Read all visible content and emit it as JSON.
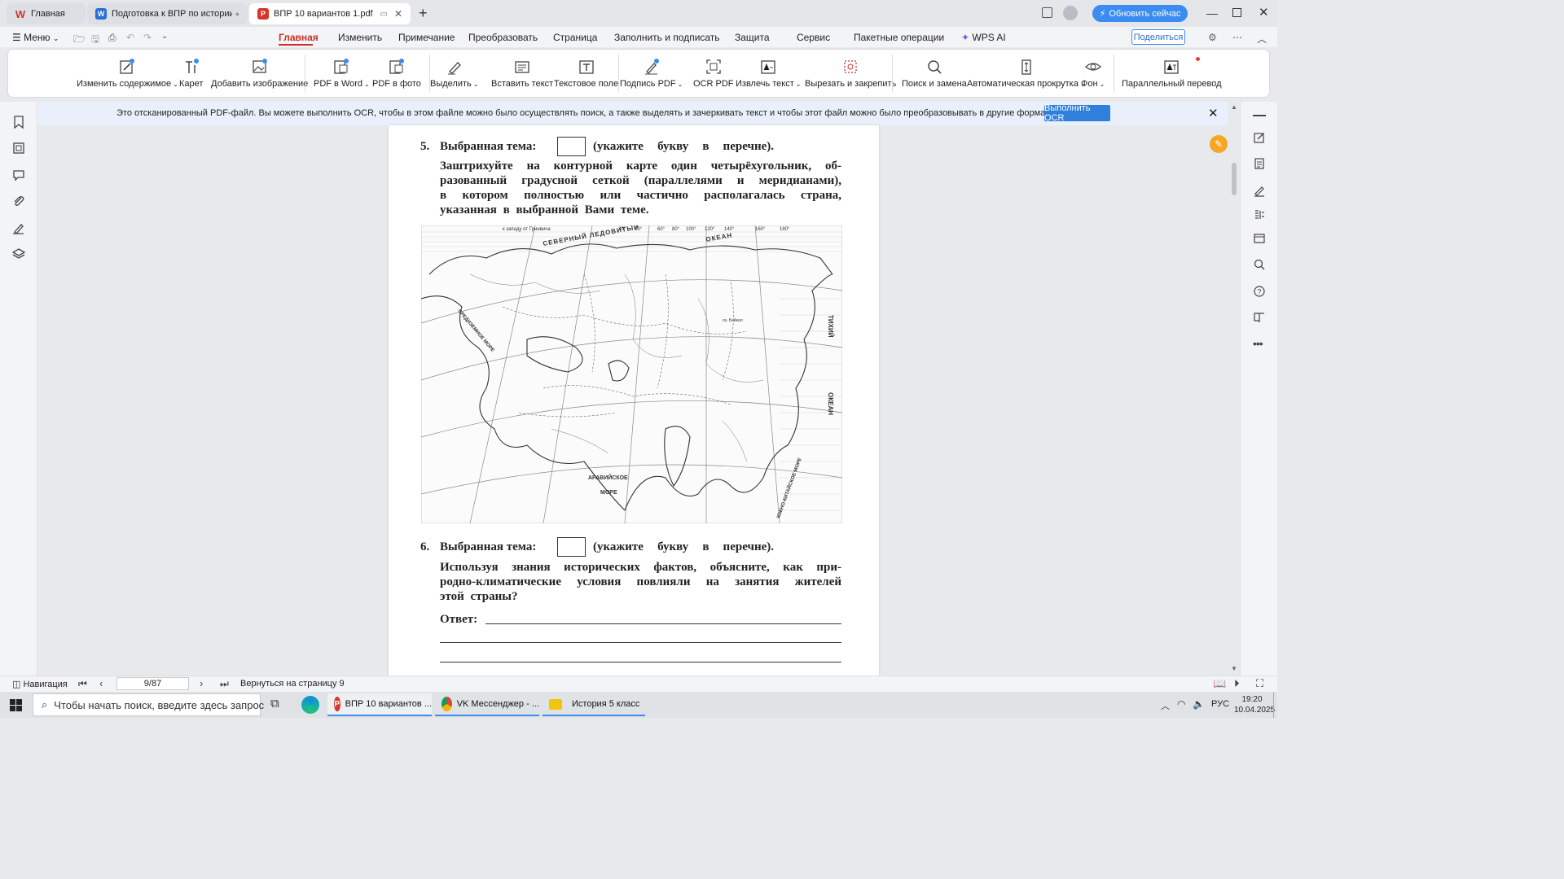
{
  "tabs": [
    {
      "label": "Главная",
      "icon": "wps-logo-icon"
    },
    {
      "label": "Подготовка к ВПР по истории в 5",
      "icon": "word-doc-icon"
    },
    {
      "label": "ВПР 10 вариантов 1.pdf",
      "icon": "pdf-icon"
    }
  ],
  "header": {
    "update_label": "Обновить сейчас",
    "share_label": "Поделиться"
  },
  "menu": {
    "menu_label": "Меню",
    "items": [
      "Главная",
      "Изменить",
      "Примечание",
      "Преобразовать",
      "Страница",
      "Заполнить и подписать",
      "Защита",
      "Сервис",
      "Пакетные операции",
      "WPS AI"
    ],
    "active": "Главная"
  },
  "ribbon": {
    "tools": [
      "Изменить содержимое",
      "Карет",
      "Добавить изображение",
      "PDF в Word",
      "PDF в фото",
      "Выделить",
      "Вставить текст",
      "Текстовое поле",
      "Подпись PDF",
      "OCR PDF",
      "Извлечь текст",
      "Вырезать и закрепить",
      "Поиск и замена",
      "Автоматическая прокрутка",
      "Фон",
      "Параллельный перевод"
    ]
  },
  "banner": {
    "text": "Это отсканированный PDF-файл. Вы можете выполнить OCR, чтобы в этом файле можно было осуществлять поиск, а также выделять и зачеркивать текст и чтобы этот файл можно было преобразовывать в другие форматы.",
    "button": "Выполнить OCR"
  },
  "document": {
    "q5": {
      "num": "5.",
      "theme_label": "Выбранная тема:",
      "theme_hint": "(укажите букву в перечне).",
      "lines": [
        "Заштрихуйте на контурной карте один четырёхугольник, об-",
        "разованный градусной сеткой (параллелями и меридианами),",
        "в котором полностью или частично располагалась страна,",
        "указанная в выбранной Вами теме."
      ]
    },
    "map": {
      "labels": [
        "к западу от Гринвича",
        "20°",
        "30°",
        "60°",
        "80°",
        "100°",
        "120°",
        "140°",
        "160°",
        "180°",
        "СЕВЕРНЫЙ ЛЕДОВИТЫЙ",
        "ОКЕАН",
        "ТИХИЙ",
        "ОКЕАН",
        "АРАВИЙСКОЕ",
        "МОРЕ",
        "ЮЖНО-КИТАЙСКОЕ МОРЕ",
        "СРЕДИЗЕМНОЕ МОРЕ",
        "оз. Байкал"
      ]
    },
    "q6": {
      "num": "6.",
      "theme_label": "Выбранная тема:",
      "theme_hint": "(укажите букву в перечне).",
      "lines": [
        "Используя знания исторических фактов, объясните, как при-",
        "родно-климатические условия повлияли на занятия жителей",
        "этой страны?"
      ],
      "answer_label": "Ответ:"
    }
  },
  "status": {
    "nav_label": "Навигация",
    "page_value": "9/87",
    "return_label": "Вернуться на страницу 9"
  },
  "taskbar": {
    "search_placeholder": "Чтобы начать поиск, введите здесь запрос",
    "apps": [
      "ВПР 10 вариантов ...",
      "VK Мессенджер - ...",
      "История 5 класс"
    ],
    "lang": "РУС",
    "time": "19:20",
    "date": "10.04.2025"
  },
  "colors": {
    "accent_red": "#c9302c",
    "ocr_button": "#2f7fdc",
    "update_button": "#3b8cf0"
  }
}
